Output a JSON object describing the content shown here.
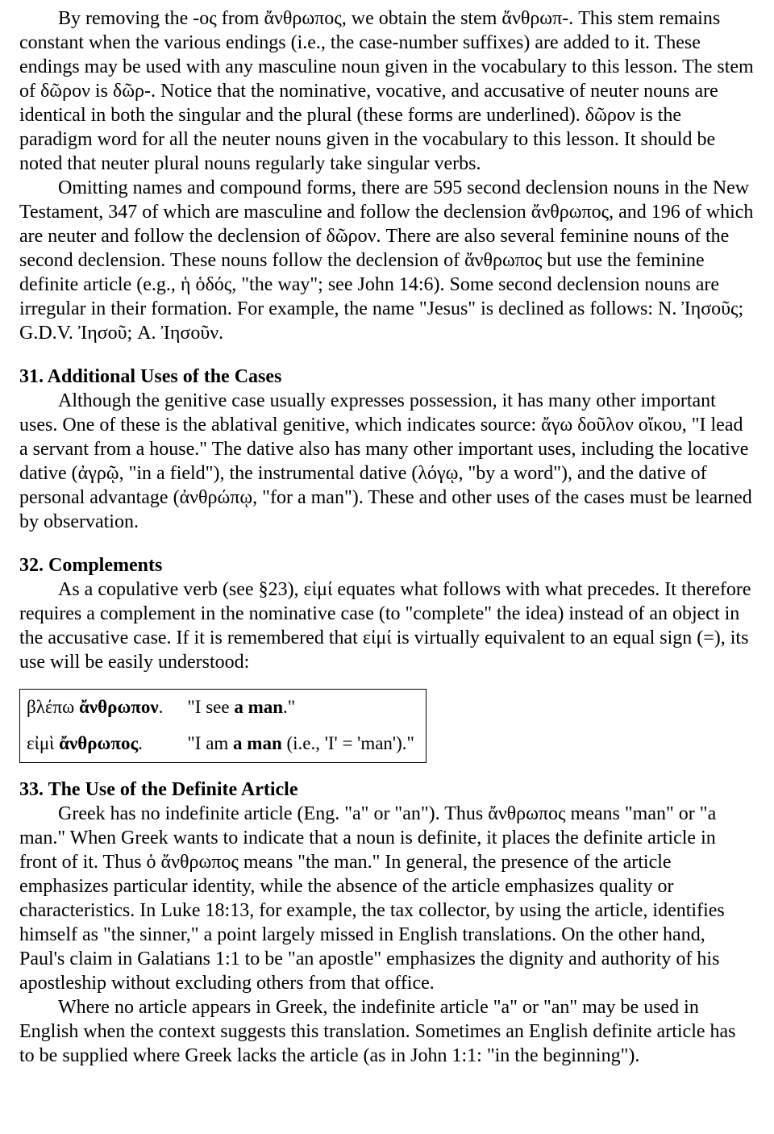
{
  "intro": {
    "p1": "By removing the -ος from ἄνθρωπος, we obtain the stem ἄνθρωπ-. This stem remains constant when the various endings (i.e., the case-number suffixes) are added to it. These endings may be used with any masculine noun given in the vocabulary to this lesson. The stem of δῶρον is δῶρ-. Notice that the nominative, vocative, and accusative of neuter nouns are identical in both the singular and the plural (these forms are underlined). δῶρον is the paradigm word for all the neuter nouns given in the vocabulary to this lesson. It should be noted that neuter plural nouns regularly take singular verbs.",
    "p2": "Omitting names and compound forms, there are 595 second declension nouns in the New Testament, 347 of which are masculine and follow the declension ἄνθρωπος, and 196 of which are neuter and follow the declension of δῶρον. There are also several feminine nouns of the second declension. These nouns follow the declension of ἄνθρωπος but use the feminine definite article (e.g., ἡ ὁδός, \"the way\"; see John 14:6). Some second declension nouns are irregular in their formation. For example, the name \"Jesus\" is declined as follows: N. Ἰησοῦς; G.D.V. Ἰησοῦ; A. Ἰησοῦν."
  },
  "s31": {
    "heading": "31. Additional Uses of the Cases",
    "body": "Although the genitive case usually expresses possession, it has many other important uses. One of these is the ablatival genitive, which indicates source: ἄγω δοῦλον οἴκου, \"I lead a servant from a house.\" The dative also has many other important uses, including the locative dative (ἀγρῷ, \"in a field\"), the instrumental dative (λόγῳ, \"by a word\"), and the dative of personal advantage (ἀνθρώπῳ, \"for a man\"). These and other uses of the cases must be learned by observation."
  },
  "s32": {
    "heading": "32. Complements",
    "body": "As a copulative verb (see §23), εἰμί equates what follows with what precedes. It therefore requires a complement in the nominative case (to \"complete\" the idea) instead of an object in the accusative case. If it is remembered that εἰμί is virtually equivalent to an equal sign (=), its use will be easily understood:",
    "examples": [
      {
        "greek_pre": "βλέπω ",
        "greek_bold": "ἄνθρωπον",
        "greek_post": ".",
        "eng_pre": "\"I see ",
        "eng_bold": "a man",
        "eng_post": ".\""
      },
      {
        "greek_pre": "εἰμὶ ",
        "greek_bold": "ἄνθρωπος",
        "greek_post": ".",
        "eng_pre": "\"I am ",
        "eng_bold": "a man",
        "eng_post": " (i.e., 'I' = 'man').\""
      }
    ]
  },
  "s33": {
    "heading": "33. The Use of the Definite Article",
    "body1": "Greek has no indefinite article (Eng. \"a\" or \"an\"). Thus ἄνθρωπος means \"man\" or \"a man.\" When Greek wants to indicate that a noun is definite, it places the definite article in front of it. Thus ὁ ἄνθρωπος means \"the man.\" In general, the presence of the article emphasizes particular identity, while the absence of the article emphasizes quality or characteristics. In Luke 18:13, for example, the tax collector, by using the article, identifies himself as \"the sinner,\" a point largely missed in English translations. On the other hand, Paul's claim in Galatians 1:1 to be \"an apostle\" emphasizes the dignity and authority of his apostleship without excluding others from that office.",
    "body2": "Where no article appears in Greek, the indefinite article \"a\" or \"an\" may be used in English when the context suggests this translation. Sometimes an English definite article has to be supplied where Greek lacks the article (as in John 1:1: \"in the beginning\")."
  }
}
